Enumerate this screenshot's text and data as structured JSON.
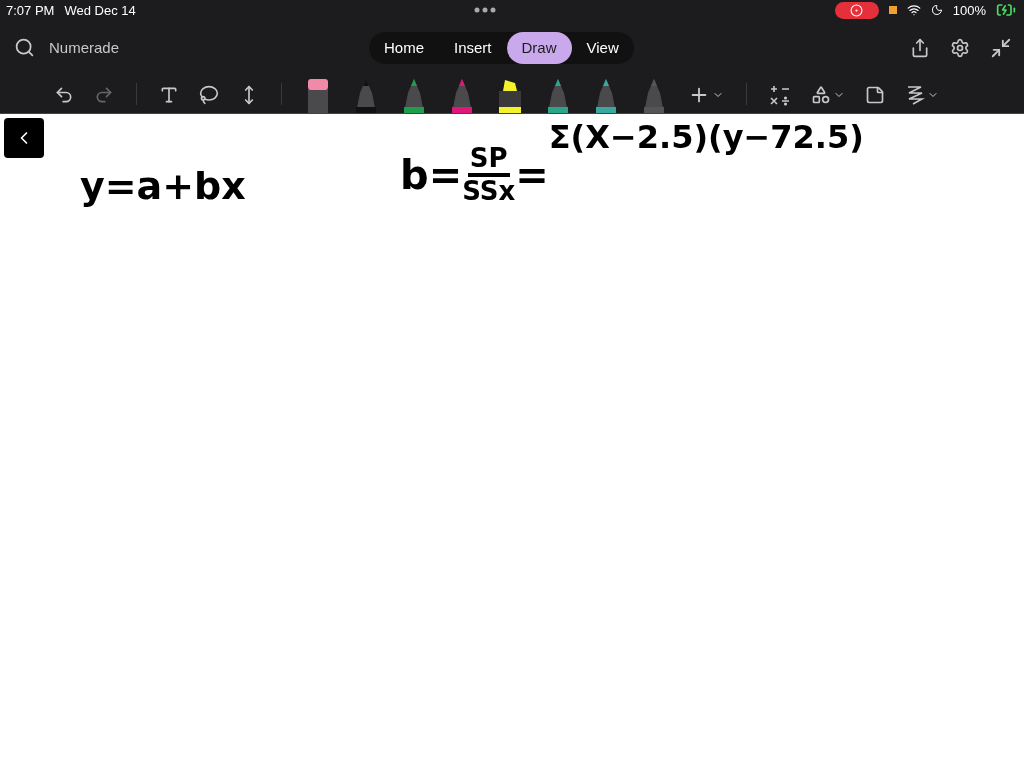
{
  "status_bar": {
    "time": "7:07 PM",
    "date": "Wed Dec 14",
    "battery": "100%"
  },
  "header": {
    "title": "Numerade"
  },
  "tabs": [
    {
      "label": "Home",
      "selected": false
    },
    {
      "label": "Insert",
      "selected": false
    },
    {
      "label": "Draw",
      "selected": true
    },
    {
      "label": "View",
      "selected": false
    }
  ],
  "pens": [
    {
      "kind": "eraser",
      "color": "#f08aa8"
    },
    {
      "kind": "pen",
      "color": "#111111"
    },
    {
      "kind": "pen",
      "color": "#1e9e4a"
    },
    {
      "kind": "pen",
      "color": "#e0177a"
    },
    {
      "kind": "highlighter",
      "color": "#f4f22a"
    },
    {
      "kind": "pen",
      "color": "#2aa58a"
    },
    {
      "kind": "pen",
      "color": "#3aa7a0"
    },
    {
      "kind": "pen",
      "color": "#555555"
    }
  ],
  "canvas": {
    "equation": "y=a+bx",
    "slope": {
      "lhs": "b=",
      "numerator": "SP",
      "denominator": "SSx",
      "equals": "=",
      "rhs": "Σ(X−2.5)(y−72.5)"
    }
  }
}
